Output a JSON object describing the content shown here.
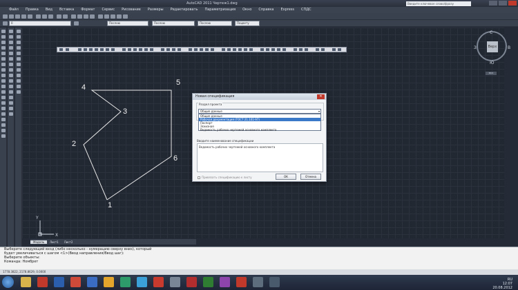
{
  "window": {
    "title": "AutoCAD 2011   Чертеж1.dwg",
    "search_placeholder": "Введите ключевое слово/фразу"
  },
  "menu": [
    "Файл",
    "Правка",
    "Вид",
    "Вставка",
    "Формат",
    "Сервис",
    "Рисование",
    "Размеры",
    "Редактировать",
    "Параметризация",
    "Окно",
    "Справка",
    "Express",
    "СПДС"
  ],
  "toolbar": {
    "layer_dropdown": "0",
    "color_dropdown": "Послою",
    "linetype_dropdown": "Послою",
    "lineweight_dropdown": "Послою",
    "plot_style_dropdown": "Поцвету"
  },
  "viewcube": {
    "face": "Верх",
    "north": "С",
    "south": "Ю",
    "west": "З",
    "east": "В",
    "wcs": "МСК"
  },
  "drawing": {
    "points": [
      "1",
      "2",
      "3",
      "4",
      "5",
      "6"
    ]
  },
  "dialog": {
    "title": "Новая спецификация",
    "group_label": "Раздел проекта",
    "selected_value": "Общие данные",
    "options": [
      "Общие данные",
      "Рабочая документация (ГОСТ 21.101-97)",
      "Паспорт",
      "Эскизная",
      "Ведомость рабочих чертежей основного комплекта"
    ],
    "name_label": "Вводите наименование спецификации",
    "name_value": "Ведомость рабочих чертежей основного комплекта",
    "checkbox_label": "Привязать спецификацию к листу",
    "ok_label": "ОК",
    "cancel_label": "Отмена"
  },
  "tabs": [
    "Модель",
    "Лист1",
    "Лист2"
  ],
  "command_line": [
    "Выберите следующий вход (либо несколько - нумерацию сверху вниз), который",
    "будет увеличиваться с шагом <1>(Ввод направления/Ввод шаг):",
    "Выберите объекты:",
    "Команда: Номбрет"
  ],
  "status": {
    "coords": "1778.3822, 2178.8629, 0.0000"
  },
  "taskbar": {
    "language": "RU",
    "time": "12:07",
    "date": "20.08.2012"
  },
  "colors": {
    "canvas": "#222832",
    "accent": "#3a78c8",
    "close": "#c0392b"
  }
}
